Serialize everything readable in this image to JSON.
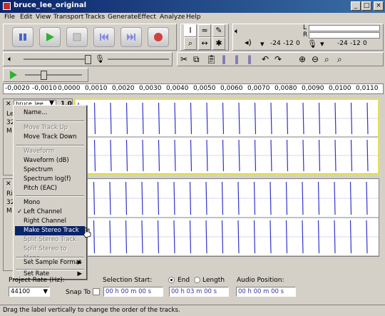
{
  "window": {
    "title": "bruce_lee_original",
    "min": "_",
    "max": "□",
    "close": "×"
  },
  "menubar": [
    "File",
    "Edit",
    "View",
    "Transport",
    "Tracks",
    "Generate",
    "Effect",
    "Analyze",
    "Help"
  ],
  "meters": {
    "left_label": "L",
    "right_label": "R",
    "ticks": [
      "-24",
      "-12",
      "0"
    ]
  },
  "ruler": [
    "-0,0020",
    "-0,0010",
    "0,0000",
    "0,0010",
    "0,0020",
    "0,0030",
    "0,0040",
    "0,0050",
    "0,0060",
    "0,0070",
    "0,0080",
    "0,0090",
    "0,0100",
    "0,0110"
  ],
  "tracks": [
    {
      "name": "bruce_lee",
      "gain": "1,0",
      "info_a": "Le",
      "info_b": "32",
      "info_c": "M"
    },
    {
      "name": "",
      "info_a": "Ri",
      "info_b": "32",
      "info_c": "M"
    }
  ],
  "menu": {
    "name": "Name...",
    "move_up": "Move Track Up",
    "move_down": "Move Track Down",
    "waveform": "Waveform",
    "waveform_db": "Waveform (dB)",
    "spectrum": "Spectrum",
    "spectrum_log": "Spectrum log(f)",
    "pitch": "Pitch (EAC)",
    "mono": "Mono",
    "left_channel": "Left Channel",
    "right_channel": "Right Channel",
    "make_stereo": "Make Stereo Track",
    "split_stereo": "Split Stereo Track",
    "split_mono": "Split Stereo to Mono",
    "sample_format": "Set Sample Format",
    "set_rate": "Set Rate",
    "check": "✓",
    "submenu_arrow": "▶"
  },
  "selection": {
    "project_rate_label": "Project Rate (Hz):",
    "project_rate_value": "44100",
    "snap_to": "Snap To",
    "selection_start_label": "Selection Start:",
    "end_label": "End",
    "length_label": "Length",
    "audio_position_label": "Audio Position:",
    "start_value": "00 h 00 m 00 s",
    "end_value": "00 h 03 m 00 s",
    "audio_position_value": "00 h 00 m 00 s"
  },
  "status_text": "Drag the label vertically to change the order of the tracks.",
  "colors": {
    "waveform": "#3232c8",
    "selection": "#0a246a",
    "clip_bg": "#ffffff"
  }
}
